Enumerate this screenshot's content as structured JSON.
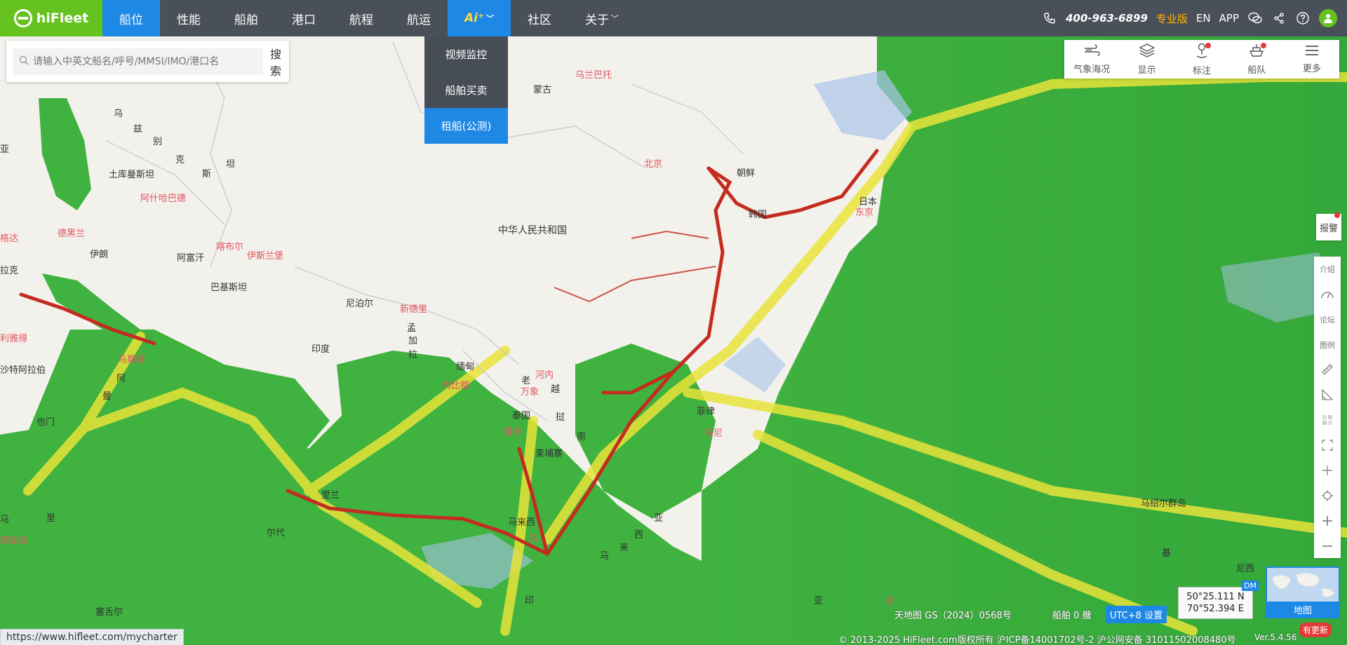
{
  "brand": {
    "name": "hiFleet"
  },
  "nav": {
    "items": [
      {
        "label": "船位",
        "active": true
      },
      {
        "label": "性能"
      },
      {
        "label": "船舶"
      },
      {
        "label": "港口"
      },
      {
        "label": "航程"
      },
      {
        "label": "航运"
      },
      {
        "label": "Ai⁺"
      },
      {
        "label": "社区"
      },
      {
        "label": "关于"
      }
    ]
  },
  "ai_menu": [
    {
      "label": "视频监控"
    },
    {
      "label": "船舶买卖"
    },
    {
      "label": "租船(公测)",
      "active": true
    }
  ],
  "topright": {
    "phone": "400-963-6899",
    "pro": "专业版",
    "lang": "EN",
    "app": "APP"
  },
  "search": {
    "placeholder": "请输入中英文船名/呼号/MMSI/IMO/港口名",
    "button": "搜索"
  },
  "toolbar": [
    {
      "label": "气象海况",
      "icon": "wind-icon"
    },
    {
      "label": "显示",
      "icon": "layers-icon"
    },
    {
      "label": "标注",
      "icon": "pin-icon",
      "dot": true
    },
    {
      "label": "船队",
      "icon": "fleet-icon",
      "dot": true
    },
    {
      "label": "更多",
      "icon": "menu-icon"
    }
  ],
  "alarm": {
    "label": "报警"
  },
  "side": [
    {
      "label": "介绍"
    },
    {
      "label": "",
      "icon": "meter-icon"
    },
    {
      "label": "论坛"
    },
    {
      "label": "图例"
    },
    {
      "label": "",
      "icon": "ruler-icon"
    },
    {
      "label": "",
      "icon": "angle-icon"
    },
    {
      "label": "",
      "icon": "grid-icon"
    },
    {
      "label": "",
      "icon": "fullscreen-icon"
    },
    {
      "label": "",
      "icon": "crosshair-icon"
    },
    {
      "label": "",
      "icon": "locate-icon"
    },
    {
      "label": "",
      "icon": "zoom-in-icon"
    },
    {
      "label": "",
      "icon": "zoom-out-icon"
    }
  ],
  "places": [
    {
      "text": "乌兰巴托",
      "red": true
    },
    {
      "text": "蒙古"
    },
    {
      "text": "乌"
    },
    {
      "text": "兹"
    },
    {
      "text": "别"
    },
    {
      "text": "克"
    },
    {
      "text": "坦"
    },
    {
      "text": "亚"
    },
    {
      "text": "土库曼斯坦"
    },
    {
      "text": "斯"
    },
    {
      "text": "阿什哈巴德",
      "red": true
    },
    {
      "text": "格达",
      "red": true
    },
    {
      "text": "德黑兰",
      "red": true
    },
    {
      "text": "伊朗"
    },
    {
      "text": "喀布尔",
      "red": true
    },
    {
      "text": "伊斯兰堡",
      "red": true
    },
    {
      "text": "阿富汗"
    },
    {
      "text": "拉克"
    },
    {
      "text": "巴基斯坦"
    },
    {
      "text": "北京",
      "red": true
    },
    {
      "text": "朝鲜"
    },
    {
      "text": "韩国"
    },
    {
      "text": "日本"
    },
    {
      "text": "东京",
      "red": true
    },
    {
      "text": "中华人民共和国",
      "big": true
    },
    {
      "text": "新德里",
      "red": true
    },
    {
      "text": "尼泊尔"
    },
    {
      "text": "印度"
    },
    {
      "text": "孟"
    },
    {
      "text": "加"
    },
    {
      "text": "拉"
    },
    {
      "text": "利雅得",
      "red": true
    },
    {
      "text": "马斯喀",
      "red": true
    },
    {
      "text": "沙特阿拉伯"
    },
    {
      "text": "阿"
    },
    {
      "text": "曼"
    },
    {
      "text": "也门"
    },
    {
      "text": "缅甸"
    },
    {
      "text": "内比都",
      "red": true
    },
    {
      "text": "老"
    },
    {
      "text": "万象",
      "red": true
    },
    {
      "text": "河内",
      "red": true
    },
    {
      "text": "越"
    },
    {
      "text": "泰国"
    },
    {
      "text": "挝"
    },
    {
      "text": "曼谷",
      "red": true
    },
    {
      "text": "南"
    },
    {
      "text": "柬埔寨"
    },
    {
      "text": "菲律"
    },
    {
      "text": "马尼",
      "red": true
    },
    {
      "text": "里兰"
    },
    {
      "text": "马来西"
    },
    {
      "text": "吉",
      "red": true
    },
    {
      "text": "亚"
    },
    {
      "text": "西"
    },
    {
      "text": "来"
    },
    {
      "text": "马"
    },
    {
      "text": "尔代"
    },
    {
      "text": "印"
    },
    {
      "text": "亚"
    },
    {
      "text": "尼",
      "red": true
    },
    {
      "text": "里"
    },
    {
      "text": "马"
    },
    {
      "text": "摩加迪",
      "red": true
    },
    {
      "text": "塞舌尔"
    },
    {
      "text": "马绍尔群岛"
    },
    {
      "text": "基"
    },
    {
      "text": "尼西"
    }
  ],
  "footer": {
    "status_url": "https://www.hifleet.com/mycharter",
    "map_note": "天地图 GS（2024）0568号",
    "ship_count": "船舶 0 艘",
    "utc": "UTC+8 设置",
    "coord_lat": "50°25.111 N",
    "coord_lon": "70°52.394 E",
    "dm": "DM",
    "minimap_label": "地图",
    "copyright": "© 2013-2025 HiFleet.com版权所有 沪ICP备14001702号-2 沪公网安备 31011502008480号",
    "version": "Ver.5.4.56",
    "update": "有更新"
  },
  "colors": {
    "nav_bg": "#3c424c",
    "accent": "#1e88e5",
    "brand_green": "#66c21e",
    "sea_traffic_low": "#3cb43c",
    "sea_traffic_mid": "#e6e61e",
    "sea_traffic_high": "#c8281e"
  }
}
